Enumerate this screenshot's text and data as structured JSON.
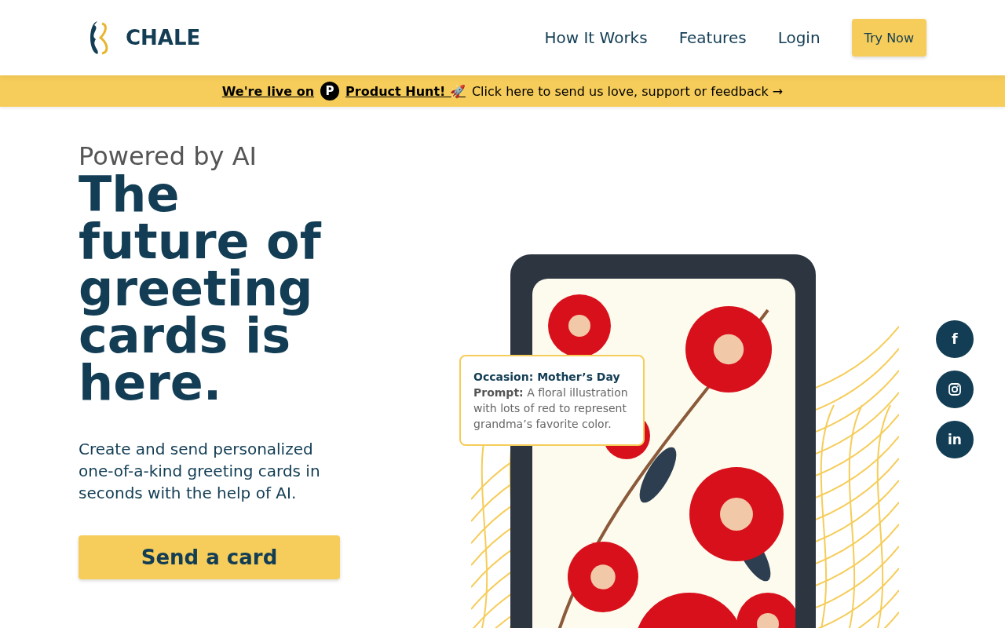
{
  "header": {
    "brand": "CHALE",
    "nav": [
      "How It Works",
      "Features",
      "Login"
    ],
    "cta": "Try Now"
  },
  "banner": {
    "live": "We're live on",
    "badge": "P",
    "product": "Product Hunt! 🚀",
    "message": "Click here to send us love, support or feedback →"
  },
  "hero": {
    "eyebrow": "Powered by AI",
    "title": "The future of greeting cards is here.",
    "description": "Create and send personalized one-of-a-kind greeting cards in seconds with the help of AI.",
    "button": "Send a card"
  },
  "tooltip": {
    "occasion": "Occasion: Mother’s Day",
    "prompt": "**Prompt:** A floral illustration with lots of red to represent grandma’s favorite color."
  },
  "social": [
    {
      "kind": "facebook",
      "label": "f"
    },
    {
      "kind": "instagram"
    },
    {
      "kind": "linkedin",
      "label": "in"
    }
  ]
}
